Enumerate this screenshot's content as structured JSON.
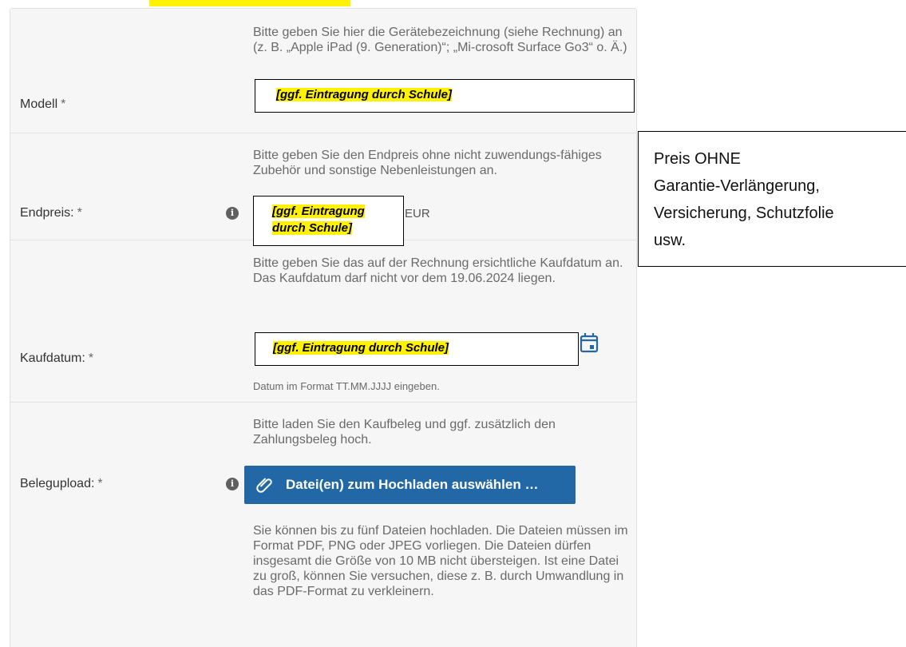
{
  "overlay_text": "[ggf. Eintragung durch Schule]",
  "price_overlay": {
    "line1": "[ggf. Eintragung",
    "line2": "durch Schule]"
  },
  "rows": {
    "modell": {
      "label": "Modell",
      "required": "*",
      "hint": "Bitte geben Sie hier die Gerätebezeichnung (siehe Rechnung) an (z. B. „Apple iPad (9. Generation)“; „Mi-crosoft Surface Go3“ o. Ä.)"
    },
    "endpreis": {
      "label": "Endpreis:",
      "required": "*",
      "hint": "Bitte geben Sie den Endpreis ohne nicht zuwendungs-fähiges Zubehör und sonstige Nebenleistungen an.",
      "unit": "EUR"
    },
    "kaufdatum": {
      "label": "Kaufdatum:",
      "required": "*",
      "hint": "Bitte geben Sie das auf der Rechnung ersichtliche Kaufdatum an. Das Kaufdatum darf nicht vor dem 19.06.2024 liegen.",
      "format_hint": "Datum im Format TT.MM.JJJJ eingeben."
    },
    "belegupload": {
      "label": "Belegupload:",
      "required": "*",
      "hint": "Bitte laden Sie den Kaufbeleg und ggf. zusätzlich den Zahlungsbeleg hoch.",
      "button_label": "Datei(en) zum Hochladen auswählen …",
      "note": "Sie können bis zu fünf Dateien hochladen. Die Dateien müssen im Format PDF, PNG oder JPEG vorliegen. Die Dateien dürfen insgesamt die Größe von 10 MB nicht übersteigen. Ist eine Datei zu groß, können Sie versuchen, diese z. B. durch Umwandlung in das PDF-Format zu verkleinern."
    }
  },
  "callout": {
    "lines": [
      "Preis OHNE",
      "Garantie-Verlängerung,",
      "Versicherung, Schutzfolie",
      "usw."
    ]
  },
  "icons": {
    "info": "info-icon",
    "calendar": "calendar-icon",
    "attachment": "paperclip-icon"
  },
  "colors": {
    "panel_bg": "#f6f6f6",
    "button_bg": "#2268a7",
    "highlight": "#fff200"
  }
}
